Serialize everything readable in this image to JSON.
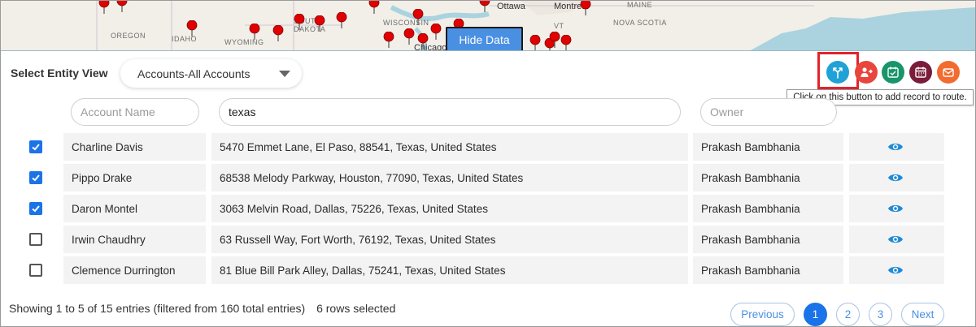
{
  "map": {
    "labels": [
      "Ottawa",
      "Montreal",
      "MAINE",
      "NOVA SCOTIA",
      "OREGON",
      "IDAHO",
      "WYOMING",
      "SOUTH DAKOTA",
      "WISCONSIN",
      "Chicago",
      "VT"
    ],
    "hide_button": "Hide Data"
  },
  "toolbar": {
    "entity_label": "Select Entity View",
    "entity_value": "Accounts-All Accounts",
    "actions": [
      {
        "icon": "route-icon",
        "color": "#1fa2d6"
      },
      {
        "icon": "assign-user-icon",
        "color": "#e8453c"
      },
      {
        "icon": "calendar-check-icon",
        "color": "#19956b"
      },
      {
        "icon": "calendar-icon",
        "color": "#7a1d3a"
      },
      {
        "icon": "envelope-icon",
        "color": "#f26b2f"
      }
    ],
    "tooltip": "Click on this button to add record to route."
  },
  "filters": {
    "account_name_placeholder": "Account Name",
    "address_value": "texas",
    "owner_placeholder": "Owner"
  },
  "table": {
    "rows": [
      {
        "checked": true,
        "name": "Charline Davis",
        "address": "5470 Emmet Lane, El Paso, 88541, Texas, United States",
        "owner": "Prakash Bambhania"
      },
      {
        "checked": true,
        "name": "Pippo Drake",
        "address": "68538 Melody Parkway, Houston, 77090, Texas, United States",
        "owner": "Prakash Bambhania"
      },
      {
        "checked": true,
        "name": "Daron Montel",
        "address": "3063 Melvin Road, Dallas, 75226, Texas, United States",
        "owner": "Prakash Bambhania"
      },
      {
        "checked": false,
        "name": "Irwin Chaudhry",
        "address": "63 Russell Way, Fort Worth, 76192, Texas, United States",
        "owner": "Prakash Bambhania"
      },
      {
        "checked": false,
        "name": "Clemence Durrington",
        "address": "81 Blue Bill Park Alley, Dallas, 75241, Texas, United States",
        "owner": "Prakash Bambhania"
      }
    ]
  },
  "footer": {
    "showing": "Showing 1 to 5 of 15 entries (filtered from 160 total entries)",
    "selected": "6 rows selected",
    "previous": "Previous",
    "pages": [
      "1",
      "2",
      "3"
    ],
    "active_page": "1",
    "next": "Next"
  },
  "colors": {
    "accent": "#1a73e8",
    "highlight": "#e2232a",
    "pin": "#e00000"
  }
}
